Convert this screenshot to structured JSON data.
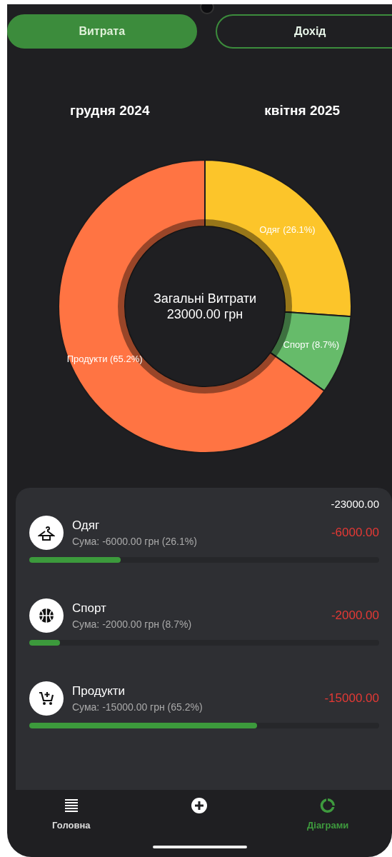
{
  "tabs": [
    {
      "label": "Витрата",
      "selected": true
    },
    {
      "label": "Дохід",
      "selected": false
    }
  ],
  "period": {
    "start": "грудня 2024",
    "end": "квітня 2025"
  },
  "chart": {
    "center_title": "Загальні Витрати",
    "center_amount": "23000.00 грн",
    "chart_data": {
      "type": "donut",
      "categories": [
        "Одяг (26.1%)",
        "Спорт (8.7%)",
        "Продукти (65.2%)"
      ],
      "values": [
        26.1,
        8.7,
        65.2
      ],
      "colors": [
        "#fcc52a",
        "#66bb6a",
        "#ff7443"
      ]
    }
  },
  "summary": {
    "total": "-23000.00",
    "categories": [
      {
        "kind": "hanger",
        "name": "Одяг",
        "sum": "Сума: -6000.00 грн (26.1%)",
        "amount": "-6000.00",
        "level": 0.261
      },
      {
        "kind": "ball",
        "name": "Спорт",
        "sum": "Сума: -2000.00 грн (8.7%)",
        "amount": "-2000.00",
        "level": 0.087
      },
      {
        "kind": "cart",
        "name": "Продукти",
        "sum": "Сума: -15000.00 грн (65.2%)",
        "amount": "-15000.00",
        "level": 0.652
      }
    ]
  },
  "nav": [
    {
      "kind": "list",
      "label": "Головна",
      "selected": false
    },
    {
      "kind": "add",
      "selected": false
    },
    {
      "kind": "chart",
      "label": "Діаграми",
      "selected": true
    }
  ]
}
